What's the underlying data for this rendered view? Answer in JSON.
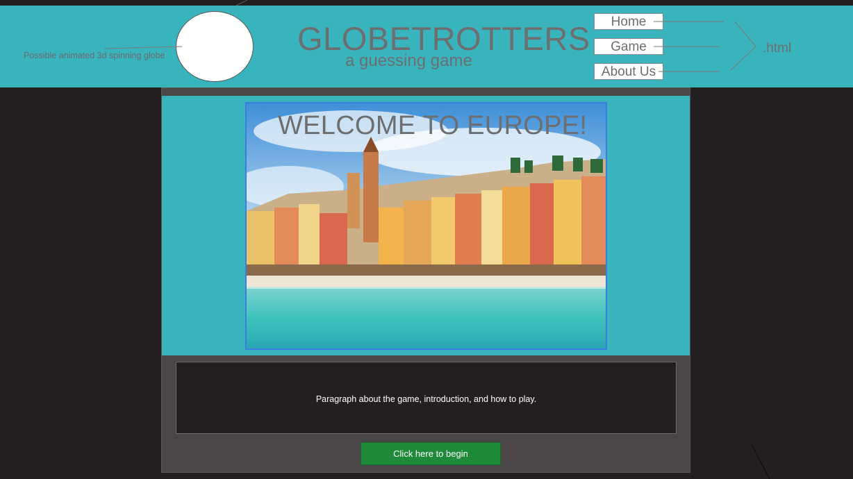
{
  "header": {
    "globe_annotation": "Possible animated 3d spinning globe",
    "title": "GLOBETROTTERS",
    "subtitle": "a guessing game",
    "nav": [
      {
        "label": "Home"
      },
      {
        "label": "Game"
      },
      {
        "label": "About Us"
      }
    ],
    "nav_annotation": ".html"
  },
  "hero": {
    "heading": "WELCOME TO EUROPE!",
    "photo": "coastal-town-photo"
  },
  "intro": {
    "text": "Paragraph about the game, introduction, and how to play."
  },
  "cta": {
    "label": "Click here to begin"
  },
  "colors": {
    "teal": "#3ab4bc",
    "background": "#231f20",
    "panel": "#4a4546",
    "button_green": "#1f8a3a",
    "text_gray": "#6d6e70"
  }
}
